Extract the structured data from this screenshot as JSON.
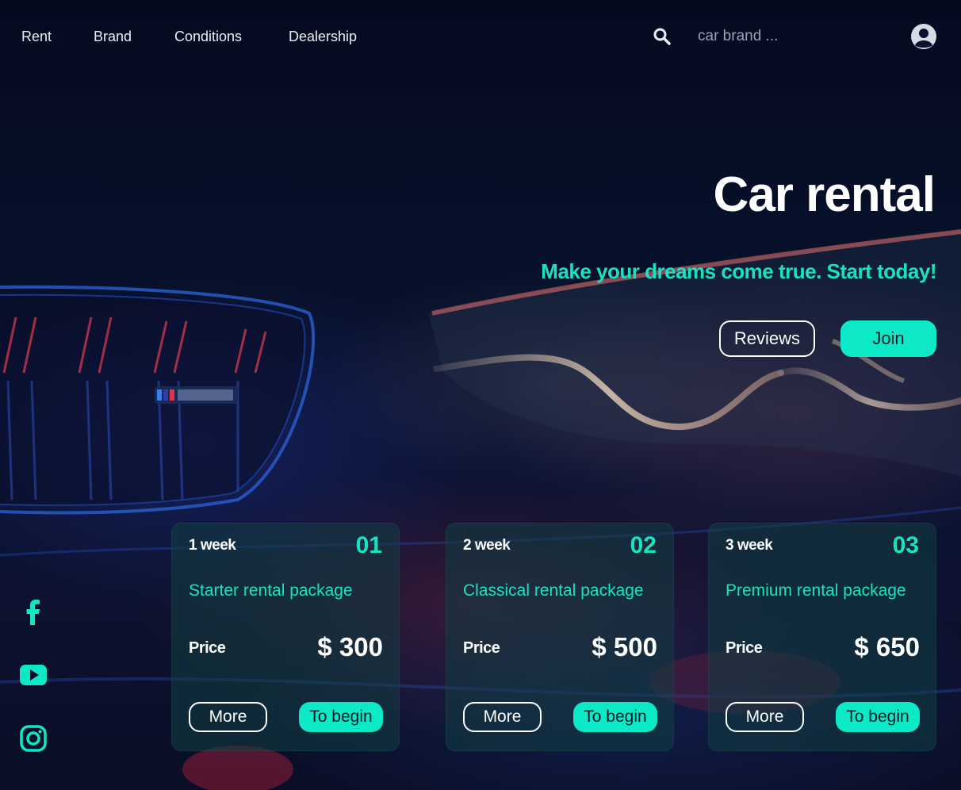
{
  "nav": {
    "links": [
      "Rent",
      "Brand",
      "Conditions",
      "Dealership"
    ]
  },
  "search": {
    "placeholder": "car brand ...",
    "icon": "search-icon"
  },
  "account": {
    "icon": "user-circle-icon"
  },
  "hero": {
    "title": "Car rental",
    "subtitle": "Make your dreams come true. Start today!",
    "reviews_label": "Reviews",
    "join_label": "Join"
  },
  "packages": [
    {
      "period": "1 week",
      "number": "01",
      "name": "Starter rental package",
      "price_label": "Price",
      "price": "$ 300",
      "more_label": "More",
      "begin_label": "To begin"
    },
    {
      "period": "2 week",
      "number": "02",
      "name": "Classical rental package",
      "price_label": "Price",
      "price": "$ 500",
      "more_label": "More",
      "begin_label": "To begin"
    },
    {
      "period": "3 week",
      "number": "03",
      "name": "Premium rental package",
      "price_label": "Price",
      "price": "$ 650",
      "more_label": "More",
      "begin_label": "To begin"
    }
  ],
  "social": [
    "facebook-icon",
    "youtube-icon",
    "instagram-icon"
  ],
  "colors": {
    "accent": "#0de8c7",
    "background": "#04071a",
    "text": "#ffffff"
  }
}
